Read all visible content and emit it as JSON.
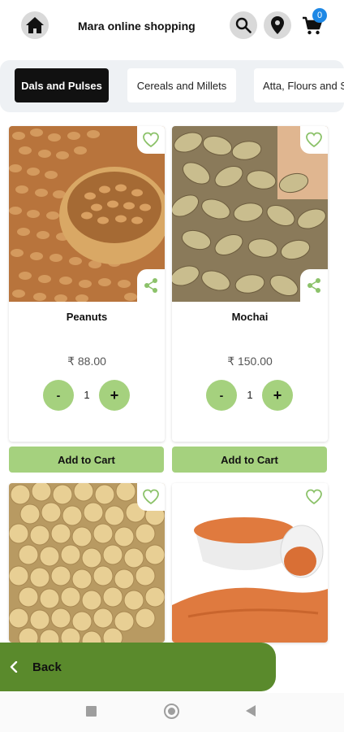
{
  "header": {
    "title": "Mara online shopping",
    "cart_count": "0"
  },
  "categories": [
    {
      "label": "Dals and Pulses",
      "active": true
    },
    {
      "label": "Cereals and Millets",
      "active": false
    },
    {
      "label": "Atta, Flours and S",
      "active": false
    }
  ],
  "products": [
    {
      "name": "Peanuts",
      "price": "₹ 88.00",
      "qty": "1",
      "add_label": "Add to Cart",
      "minus": "-",
      "plus": "+"
    },
    {
      "name": "Mochai",
      "price": "₹ 150.00",
      "qty": "1",
      "add_label": "Add to Cart",
      "minus": "-",
      "plus": "+"
    }
  ],
  "back": {
    "label": "Back"
  },
  "colors": {
    "accent": "#a5d17e",
    "back_bar": "#5a8a2c",
    "badge": "#1e88e5",
    "icon_green": "#8cc26a"
  },
  "icons": [
    "home-icon",
    "search-icon",
    "location-icon",
    "cart-icon",
    "heart-icon",
    "share-icon",
    "chevron-left-icon"
  ]
}
